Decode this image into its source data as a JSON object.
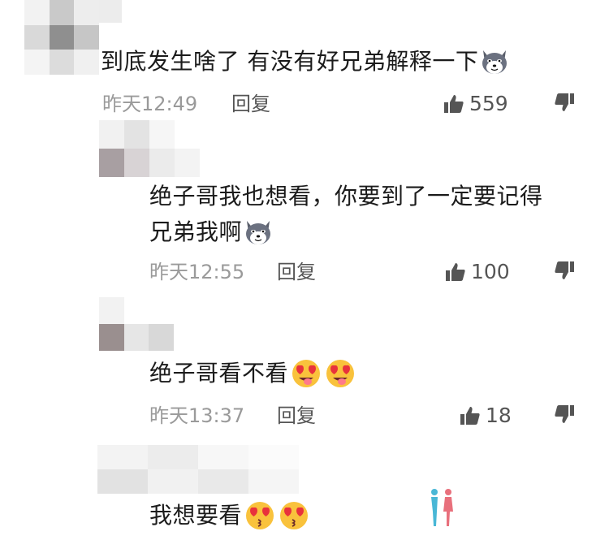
{
  "comments": [
    {
      "text": "到底发生啥了 有没有好兄弟解释一下",
      "emoji": "husky-dog-emoji",
      "time": "昨天12:49",
      "reply_label": "回复",
      "likes": "559"
    },
    {
      "text_line1": "绝子哥我也想看，你要到了一定要记得",
      "text_line2": "兄弟我啊",
      "emoji": "husky-dog-emoji",
      "time": "昨天12:55",
      "reply_label": "回复",
      "likes": "100"
    },
    {
      "text": "绝子哥看不看",
      "emoji": "heart-eyes-emoji",
      "time": "昨天13:37",
      "reply_label": "回复",
      "likes": "18"
    },
    {
      "text": "我想要看",
      "emoji": "kissing-heart-eyes-emoji"
    }
  ],
  "colors": {
    "meta": "#9a9a9a",
    "text": "#1b1b1b",
    "icon": "#555555",
    "emoji_yellow": "#f9c23c",
    "heart_red": "#e8323c"
  }
}
